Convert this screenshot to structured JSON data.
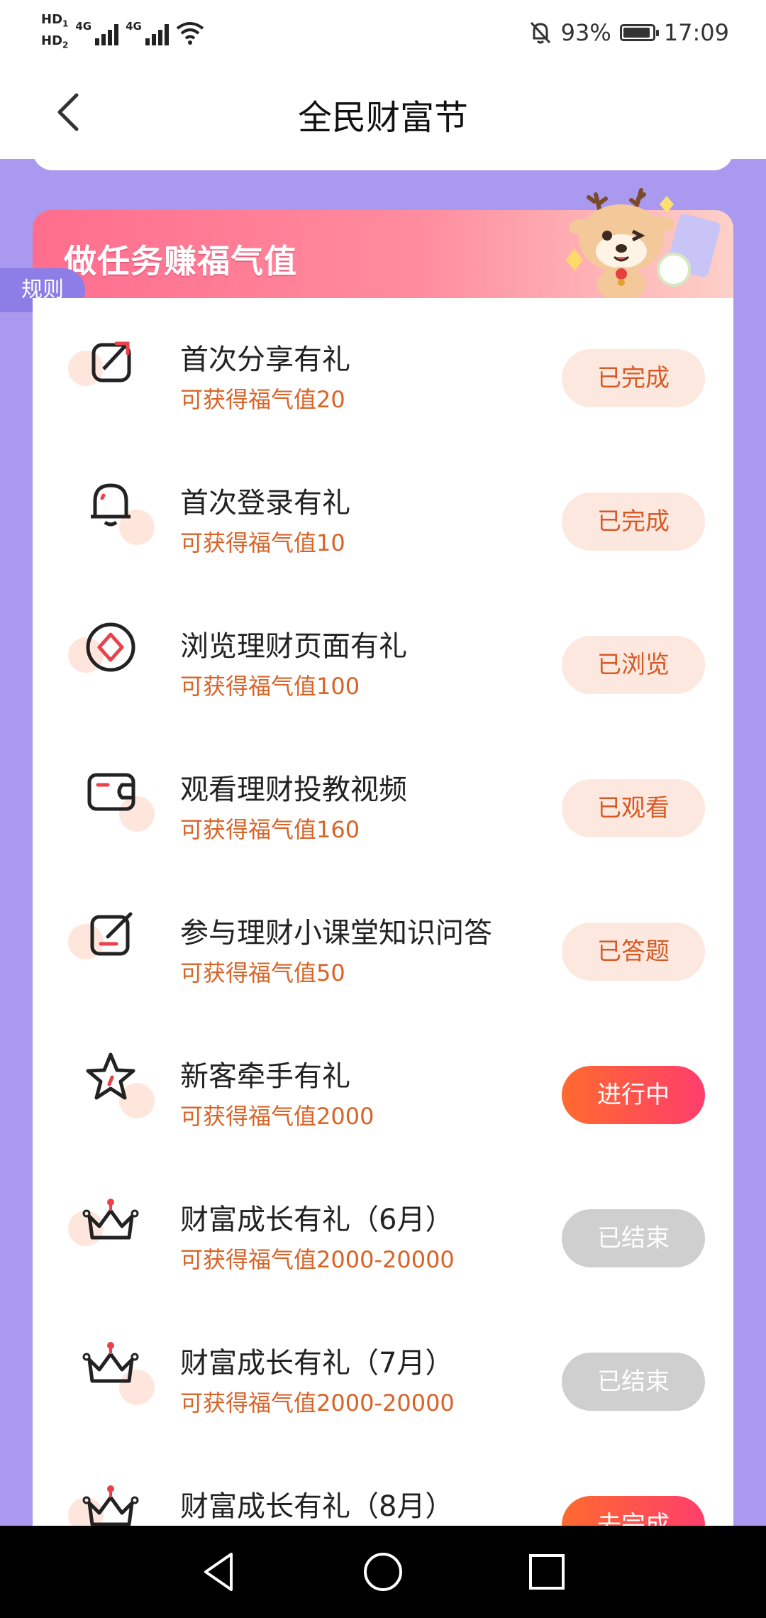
{
  "status_bar": {
    "hd1": "HD",
    "hd1_sub": "1",
    "hd2": "HD",
    "hd2_sub": "2",
    "net1": "4G",
    "net2": "4G",
    "battery_percent": "93%",
    "battery_level": 0.93,
    "time": "17:09"
  },
  "nav": {
    "title": "全民财富节"
  },
  "banner": {
    "title": "做任务赚福气值",
    "rules_label": "规则"
  },
  "tasks": [
    {
      "icon": "share-icon",
      "title": "首次分享有礼",
      "reward": "可获得福气值20",
      "button": "已完成",
      "state": "done"
    },
    {
      "icon": "bell-icon",
      "title": "首次登录有礼",
      "reward": "可获得福气值10",
      "button": "已完成",
      "state": "done"
    },
    {
      "icon": "compass-icon",
      "title": "浏览理财页面有礼",
      "reward": "可获得福气值100",
      "button": "已浏览",
      "state": "done"
    },
    {
      "icon": "wallet-icon",
      "title": "观看理财投教视频",
      "reward": "可获得福气值160",
      "button": "已观看",
      "state": "done"
    },
    {
      "icon": "edit-icon",
      "title": "参与理财小课堂知识问答",
      "reward": "可获得福气值50",
      "button": "已答题",
      "state": "done"
    },
    {
      "icon": "star-icon",
      "title": "新客牵手有礼",
      "reward": "可获得福气值2000",
      "button": "进行中",
      "state": "active"
    },
    {
      "icon": "crown-icon",
      "title": "财富成长有礼（6月）",
      "reward": "可获得福气值2000-20000",
      "button": "已结束",
      "state": "ended"
    },
    {
      "icon": "crown-icon",
      "title": "财富成长有礼（7月）",
      "reward": "可获得福气值2000-20000",
      "button": "已结束",
      "state": "ended"
    },
    {
      "icon": "crown-icon",
      "title": "财富成长有礼（8月）",
      "reward": "",
      "button": "去完成",
      "state": "active"
    }
  ],
  "colors": {
    "page_bg": "#a99af0",
    "reward_text": "#d86428",
    "done_button_bg": "#fde8df",
    "active_button": "#ff5050",
    "ended_button": "#cfcfcf"
  }
}
